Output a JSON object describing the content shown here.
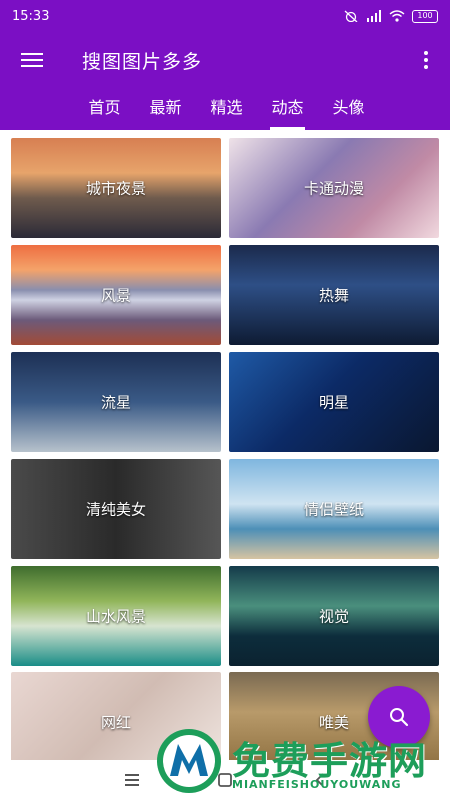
{
  "status": {
    "time": "15:33",
    "battery": "100"
  },
  "appbar": {
    "title": "搜图图片多多"
  },
  "tabs": [
    {
      "label": "首页"
    },
    {
      "label": "最新"
    },
    {
      "label": "精选"
    },
    {
      "label": "动态"
    },
    {
      "label": "头像"
    }
  ],
  "active_tab": "动态",
  "categories": [
    {
      "label": "城市夜景"
    },
    {
      "label": "卡通动漫"
    },
    {
      "label": "风景"
    },
    {
      "label": "热舞"
    },
    {
      "label": "流星"
    },
    {
      "label": "明星"
    },
    {
      "label": "清纯美女"
    },
    {
      "label": "情侣壁纸"
    },
    {
      "label": "山水风景"
    },
    {
      "label": "视觉"
    },
    {
      "label": "网红"
    },
    {
      "label": "唯美"
    }
  ],
  "watermark": {
    "title": "免费手游网",
    "subtitle": "MIANFEISHOUYOUWANG"
  },
  "colors": {
    "primary": "#7b0fc4",
    "fab": "#8a1bd1",
    "watermark": "#1d9e5a"
  },
  "icons": {
    "menu": "hamburger-icon",
    "more": "more-vert-icon",
    "fab": "search-icon"
  }
}
